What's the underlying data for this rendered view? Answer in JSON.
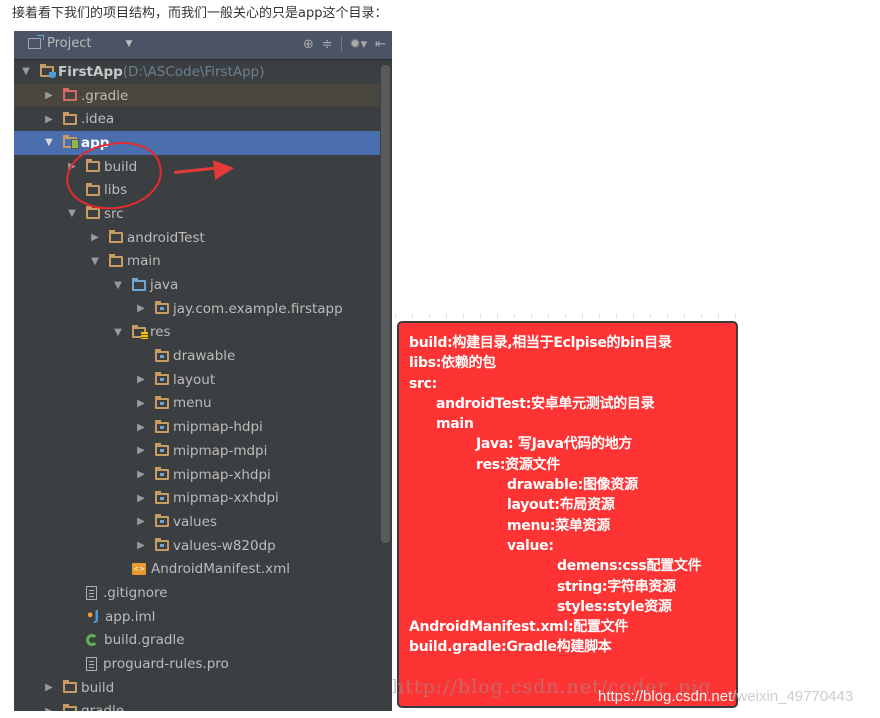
{
  "intro_text": "接着看下我们的项目结构，而我们一般关心的只是app这个目录：",
  "ide": {
    "panel_title": "Project",
    "toolbar_icons": [
      "locate-icon",
      "collapse-icon",
      "gear-icon",
      "hide-icon"
    ],
    "tree": [
      {
        "label": "FirstApp",
        "extra": " (D:\\ASCode\\FirstApp)",
        "depth": 0,
        "toggle": "expanded",
        "icon": "project-folder-icon"
      },
      {
        "label": ".gradle",
        "depth": 1,
        "toggle": "collapsed",
        "icon": "folder-excluded-icon"
      },
      {
        "label": ".idea",
        "depth": 1,
        "toggle": "collapsed",
        "icon": "folder-icon"
      },
      {
        "label": "app",
        "depth": 1,
        "toggle": "expanded",
        "icon": "module-folder-icon",
        "selected": true
      },
      {
        "label": "build",
        "depth": 2,
        "toggle": "collapsed",
        "icon": "folder-icon"
      },
      {
        "label": "libs",
        "depth": 2,
        "toggle": "none",
        "icon": "folder-icon"
      },
      {
        "label": "src",
        "depth": 2,
        "toggle": "expanded",
        "icon": "folder-icon"
      },
      {
        "label": "androidTest",
        "depth": 3,
        "toggle": "collapsed",
        "icon": "folder-icon"
      },
      {
        "label": "main",
        "depth": 3,
        "toggle": "expanded",
        "icon": "folder-icon"
      },
      {
        "label": "java",
        "depth": 4,
        "toggle": "expanded",
        "icon": "source-folder-icon"
      },
      {
        "label": "jay.com.example.firstapp",
        "depth": 5,
        "toggle": "collapsed",
        "icon": "package-icon"
      },
      {
        "label": "res",
        "depth": 4,
        "toggle": "expanded",
        "icon": "resource-folder-icon"
      },
      {
        "label": "drawable",
        "depth": 5,
        "toggle": "none",
        "icon": "package-icon"
      },
      {
        "label": "layout",
        "depth": 5,
        "toggle": "collapsed",
        "icon": "package-icon"
      },
      {
        "label": "menu",
        "depth": 5,
        "toggle": "collapsed",
        "icon": "package-icon"
      },
      {
        "label": "mipmap-hdpi",
        "depth": 5,
        "toggle": "collapsed",
        "icon": "package-icon"
      },
      {
        "label": "mipmap-mdpi",
        "depth": 5,
        "toggle": "collapsed",
        "icon": "package-icon"
      },
      {
        "label": "mipmap-xhdpi",
        "depth": 5,
        "toggle": "collapsed",
        "icon": "package-icon"
      },
      {
        "label": "mipmap-xxhdpi",
        "depth": 5,
        "toggle": "collapsed",
        "icon": "package-icon"
      },
      {
        "label": "values",
        "depth": 5,
        "toggle": "collapsed",
        "icon": "package-icon"
      },
      {
        "label": "values-w820dp",
        "depth": 5,
        "toggle": "collapsed",
        "icon": "package-icon"
      },
      {
        "label": "AndroidManifest.xml",
        "depth": 4,
        "toggle": "none",
        "icon": "xml-file-icon"
      },
      {
        "label": ".gitignore",
        "depth": 2,
        "toggle": "none",
        "icon": "text-file-icon"
      },
      {
        "label": "app.iml",
        "depth": 2,
        "toggle": "none",
        "icon": "iml-file-icon"
      },
      {
        "label": "build.gradle",
        "depth": 2,
        "toggle": "none",
        "icon": "gradle-file-icon"
      },
      {
        "label": "proguard-rules.pro",
        "depth": 2,
        "toggle": "none",
        "icon": "text-file-icon"
      },
      {
        "label": "build",
        "depth": 1,
        "toggle": "collapsed",
        "icon": "folder-icon"
      },
      {
        "label": "gradle",
        "depth": 1,
        "toggle": "collapsed",
        "icon": "folder-icon"
      }
    ]
  },
  "note": {
    "lines": [
      {
        "text": "build:构建目录,相当于Eclpise的bin目录",
        "indent": 0
      },
      {
        "text": "libs:依赖的包",
        "indent": 0
      },
      {
        "text": "src:",
        "indent": 0
      },
      {
        "text": "androidTest:安卓单元测试的目录",
        "indent": 1
      },
      {
        "text": "main",
        "indent": 1
      },
      {
        "text": "Java: 写Java代码的地方",
        "indent": 2
      },
      {
        "text": "res:资源文件",
        "indent": 2
      },
      {
        "text": "drawable:图像资源",
        "indent": 3
      },
      {
        "text": "layout:布局资源",
        "indent": 3
      },
      {
        "text": "menu:菜单资源",
        "indent": 3
      },
      {
        "text": "value:",
        "indent": 3
      },
      {
        "text": "demens:css配置文件",
        "indent": 4
      },
      {
        "text": "string:字符串资源",
        "indent": 4
      },
      {
        "text": "styles:style资源",
        "indent": 4
      },
      {
        "text": "AndroidManifest.xml:配置文件",
        "indent": 0
      },
      {
        "text": "build.gradle:Gradle构建脚本",
        "indent": 0
      }
    ],
    "background_color": "#fe3333"
  },
  "watermarks": {
    "old": "http://blog.csdn.net/coder_pig",
    "new_prefix": "https://blog.csdn.net",
    "new_suffix": "/weixin_49770443"
  }
}
